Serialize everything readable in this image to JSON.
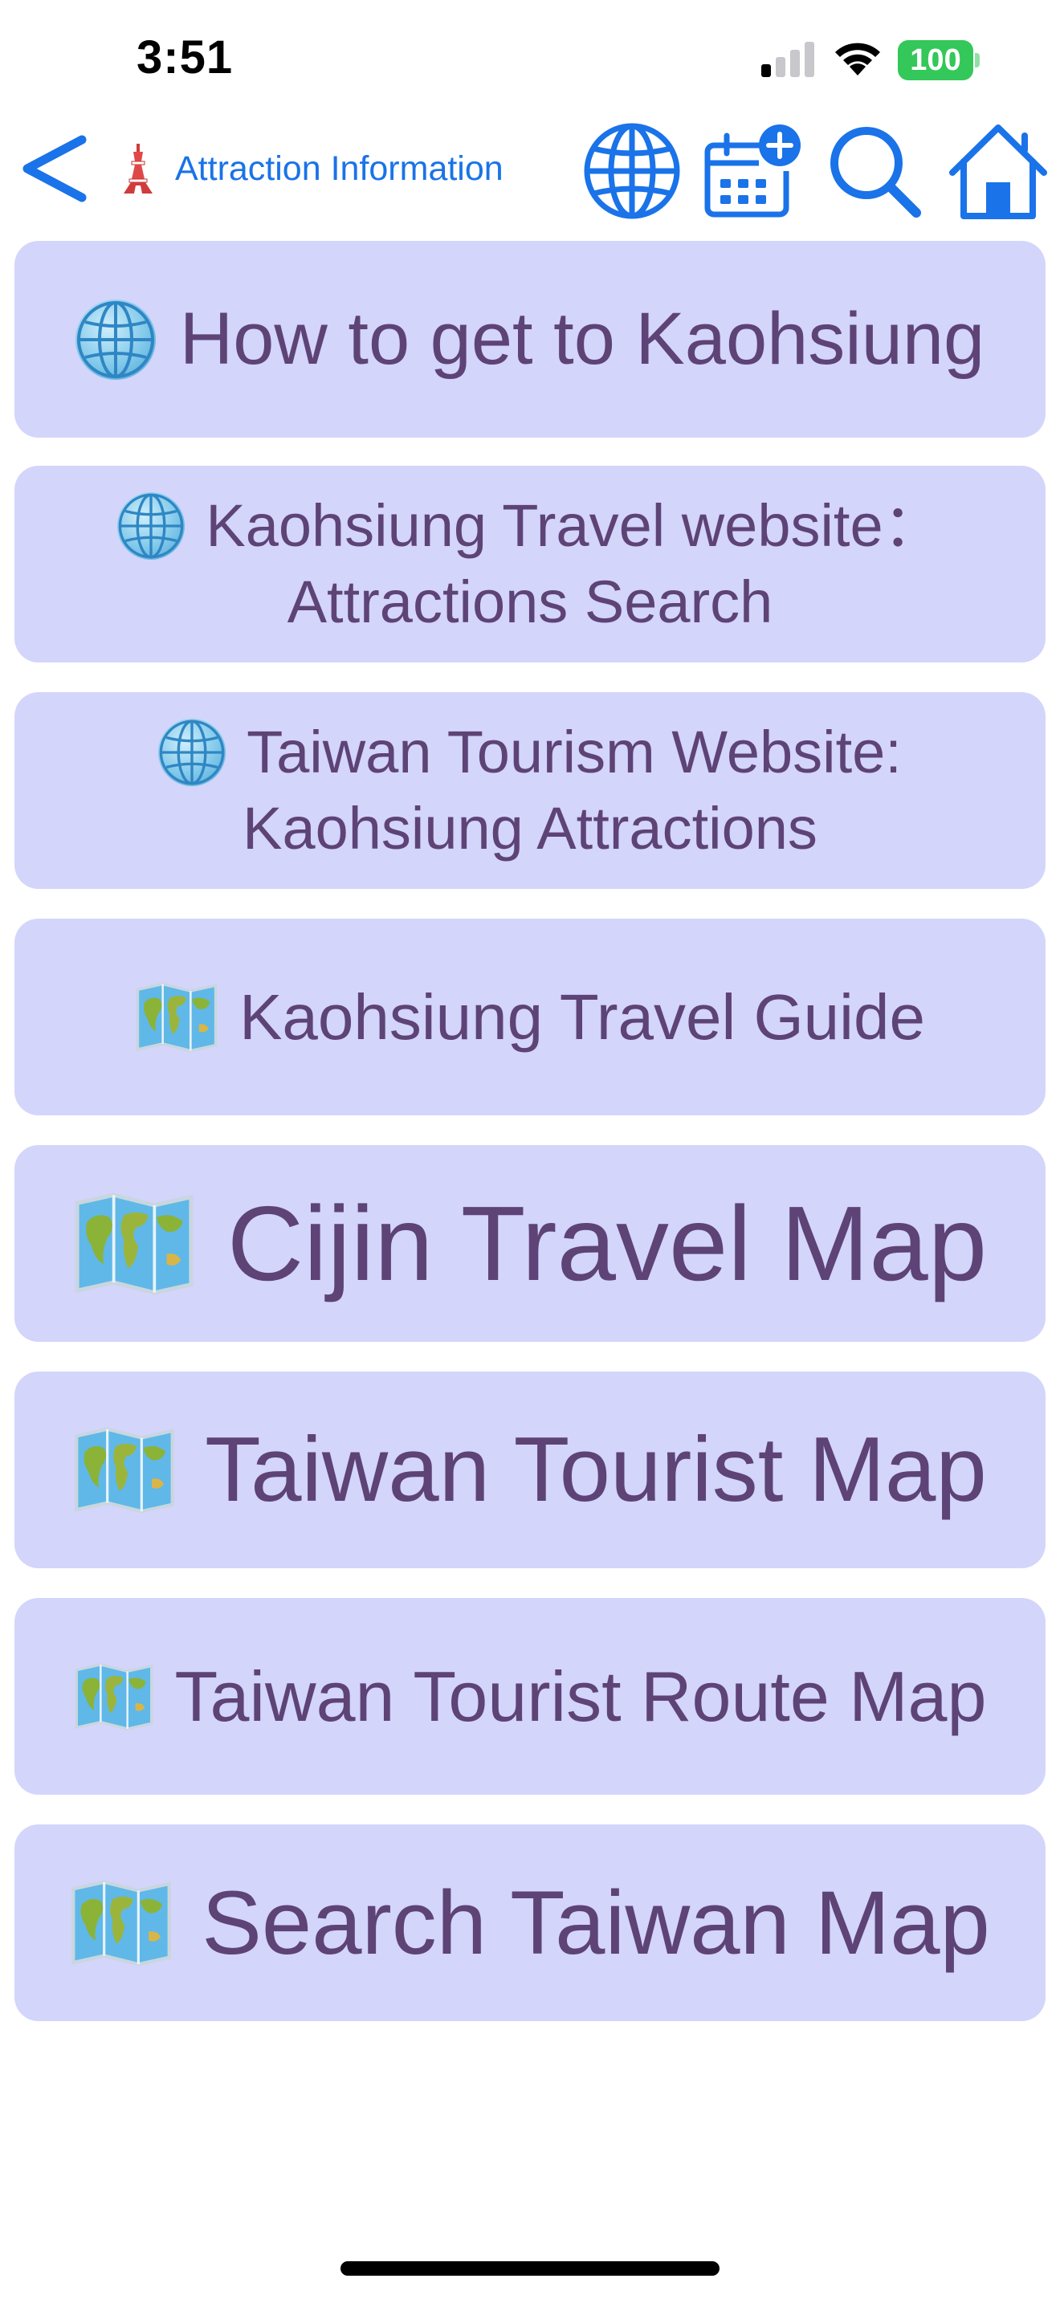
{
  "status_bar": {
    "time": "3:51",
    "battery": "100",
    "icons": [
      "signal-icon",
      "wifi-icon",
      "battery-icon"
    ]
  },
  "nav": {
    "title": "Attraction Information",
    "icons": [
      "chevron-left-icon",
      "tower-icon",
      "globe-icon",
      "calendar-add-icon",
      "search-icon",
      "home-icon"
    ]
  },
  "items": [
    {
      "label": "How to get to Kaohsiung",
      "icon": "globe-icon"
    },
    {
      "line1": "Kaohsiung Travel website：",
      "line2": "Attractions Search",
      "icon": "globe-icon"
    },
    {
      "line1": "Taiwan Tourism Website:",
      "line2": "Kaohsiung Attractions",
      "icon": "globe-icon"
    },
    {
      "label": "Kaohsiung Travel Guide",
      "icon": "world-map-icon"
    },
    {
      "label": "Cijin Travel Map",
      "icon": "world-map-icon"
    },
    {
      "label": "Taiwan Tourist Map",
      "icon": "world-map-icon"
    },
    {
      "label": "Taiwan Tourist Route Map",
      "icon": "world-map-icon"
    },
    {
      "label": "Search Taiwan Map",
      "icon": "world-map-icon"
    }
  ],
  "colors": {
    "accent": "#1a73e8",
    "item_background": "#d3d5fb",
    "item_text": "#5e4377",
    "battery": "#34c759"
  }
}
